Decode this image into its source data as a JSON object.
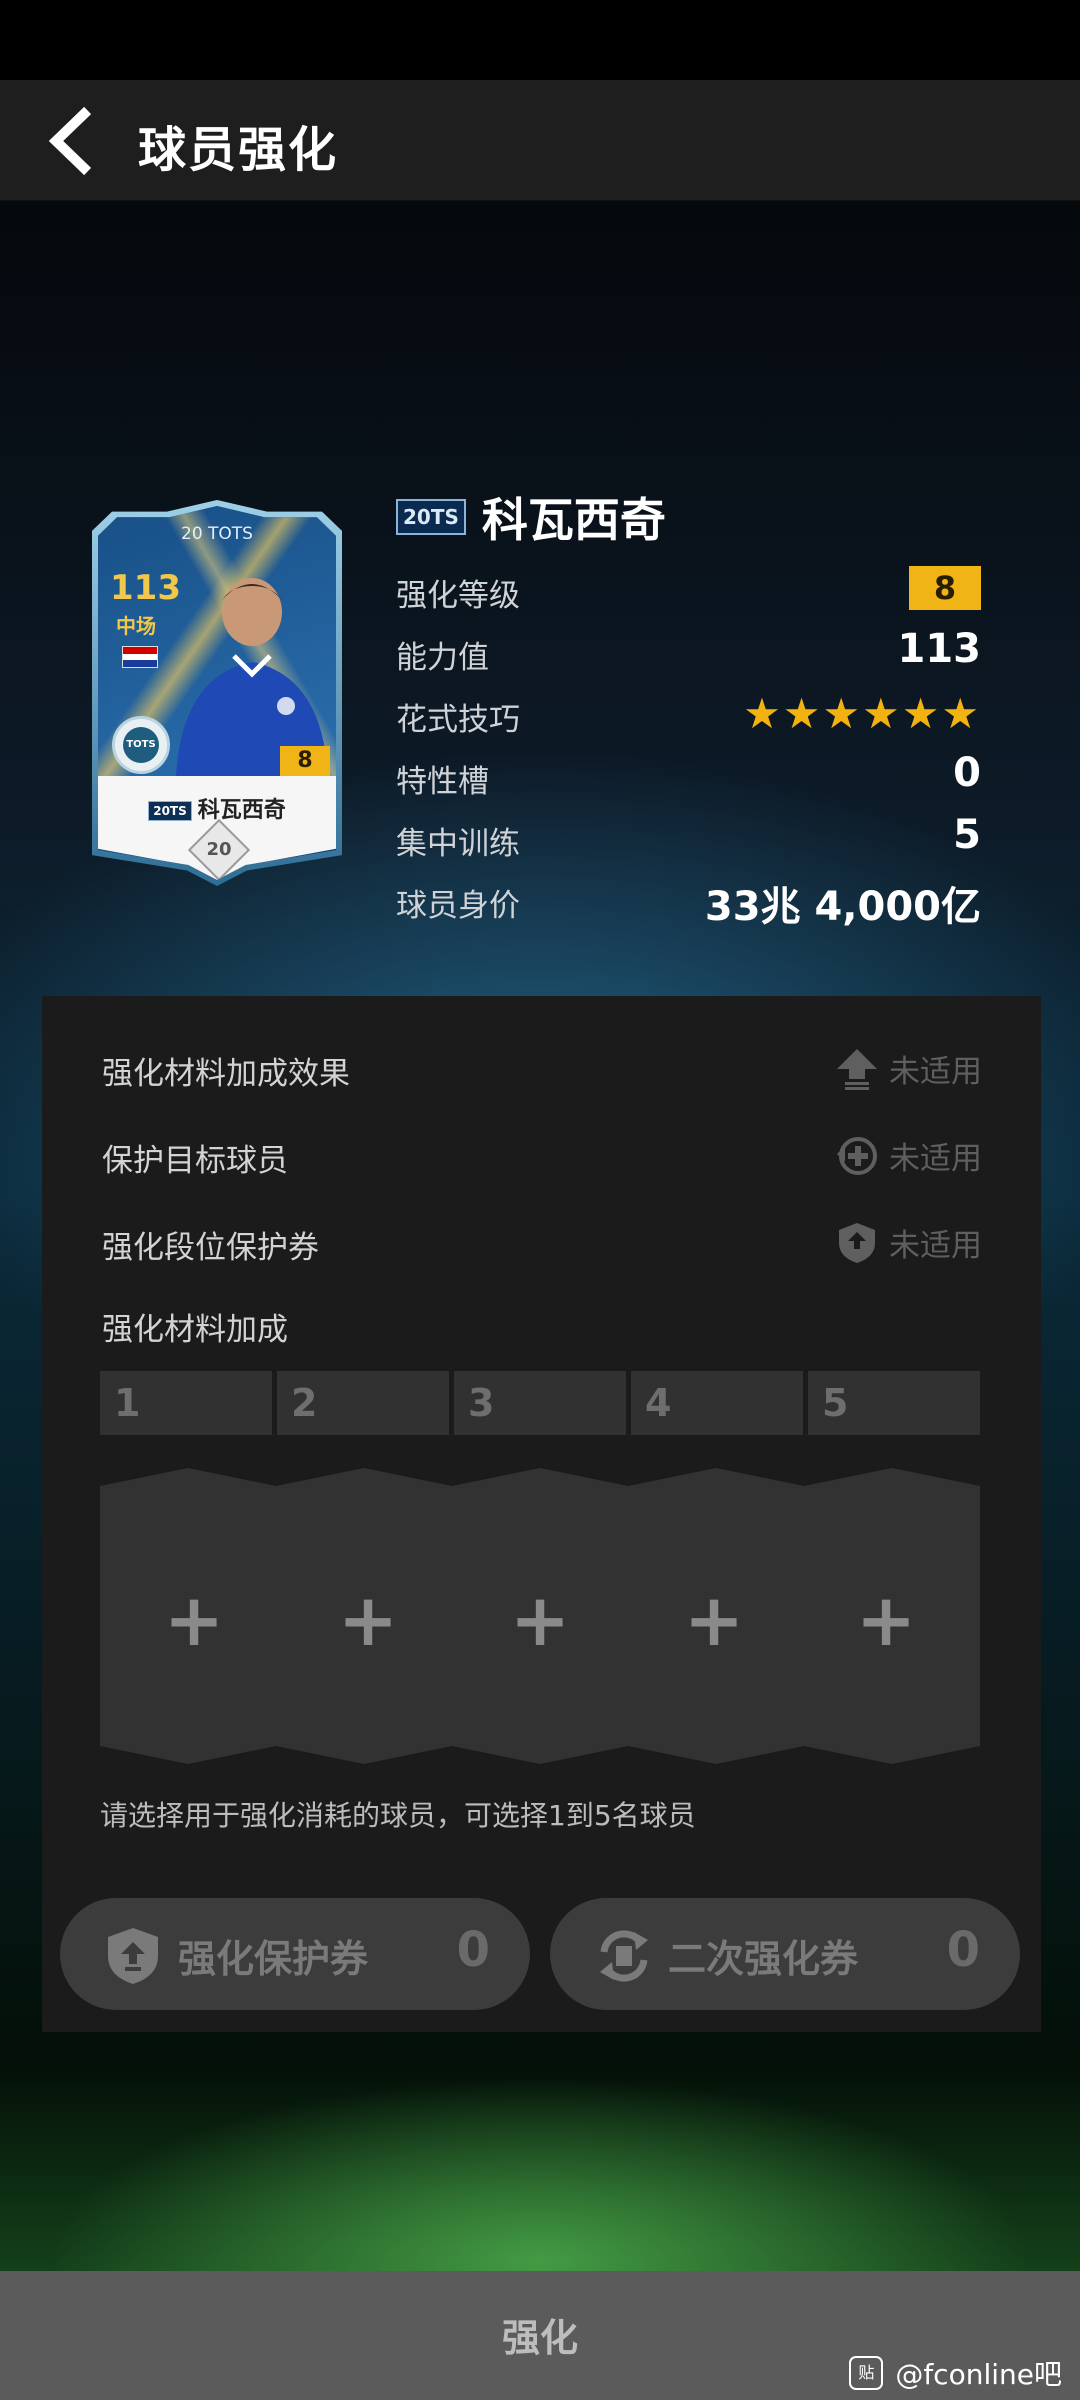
{
  "header": {
    "title": "球员强化"
  },
  "card": {
    "tots_label": "20 TOTS",
    "overall": "113",
    "position": "中场",
    "badge_text": "TOTS",
    "enhance_level": "8",
    "name": "科瓦西奇",
    "tag": "20TS",
    "season": "20"
  },
  "player": {
    "tag": "20TS",
    "name": "科瓦西奇",
    "stats": [
      {
        "label": "强化等级",
        "value": "8"
      },
      {
        "label": "能力值",
        "value": "113"
      },
      {
        "label": "花式技巧",
        "value": "★★★★★★"
      },
      {
        "label": "特性槽",
        "value": "0"
      },
      {
        "label": "集中训练",
        "value": "5"
      },
      {
        "label": "球员身价",
        "value": "33兆 4,000亿"
      }
    ],
    "skill_stars": 6
  },
  "options": [
    {
      "label": "强化材料加成效果",
      "status": "未适用",
      "icon": "upload-arrow-icon"
    },
    {
      "label": "保护目标球员",
      "status": "未适用",
      "icon": "protect-plus-icon"
    },
    {
      "label": "强化段位保护券",
      "status": "未适用",
      "icon": "shield-arrow-icon"
    }
  ],
  "materials": {
    "section_label": "强化材料加成",
    "slots": [
      "1",
      "2",
      "3",
      "4",
      "5"
    ],
    "plus": "+",
    "hint": "请选择用于强化消耗的球员，可选择1到5名球员"
  },
  "tickets": {
    "protect": {
      "label": "强化保护券",
      "count": "0"
    },
    "second": {
      "label": "二次强化券",
      "count": "0"
    }
  },
  "bottom": {
    "action": "强化"
  },
  "watermark": {
    "icon": "贴",
    "text": "@fconline吧"
  },
  "colors": {
    "accent_gold": "#f0b417",
    "star": "#f2b20f",
    "panel": "#1b1b1b",
    "disabled_text": "#5f5f5f"
  }
}
